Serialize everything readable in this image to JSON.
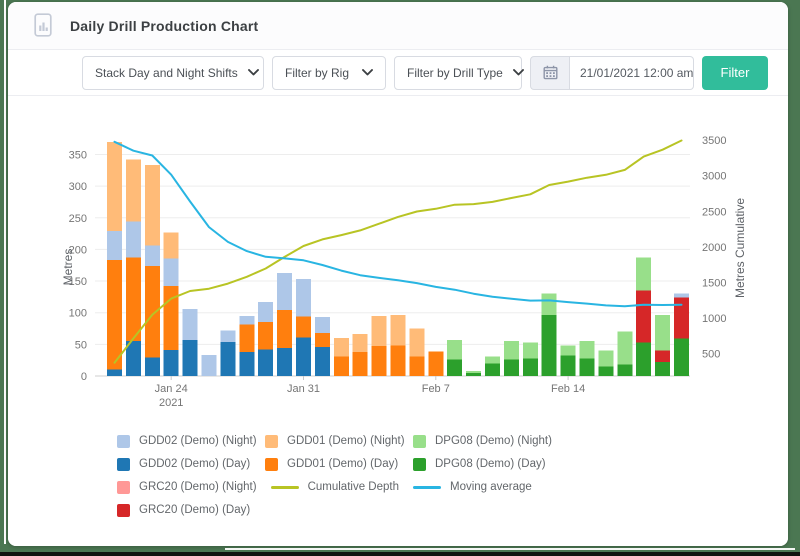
{
  "page": {
    "background_color": "#4b7752",
    "card_color": "#ffffff"
  },
  "header": {
    "title": "Daily Drill Production Chart"
  },
  "toolbar": {
    "stack_select": "Stack Day and Night Shifts",
    "rig_select": "Filter by Rig",
    "drill_type_select": "Filter by Drill Type",
    "date_value": "21/01/2021 12:00 am -",
    "filter_button": "Filter",
    "filter_button_color": "#31bd9b"
  },
  "chart_data": {
    "type": "bar",
    "subtype": "stacked-bars-with-lines",
    "ylabel_left": "Metres",
    "ylabel_right": "Metres Cumulative",
    "ylim_left": [
      0,
      375
    ],
    "ylim_right": [
      0,
      3500
    ],
    "left_ticks": [
      0,
      50,
      100,
      150,
      200,
      250,
      300,
      350
    ],
    "right_ticks": [
      500,
      1000,
      1500,
      2000,
      2500,
      3000,
      3500
    ],
    "grid": true,
    "x_tick_labels": [
      {
        "bar": 3,
        "lines": [
          "Jan 24",
          "2021"
        ]
      },
      {
        "bar": 10,
        "lines": [
          "Jan 31"
        ]
      },
      {
        "bar": 17,
        "lines": [
          "Feb 7"
        ]
      },
      {
        "bar": 24,
        "lines": [
          "Feb 14"
        ]
      }
    ],
    "series_colors": {
      "gdd02_day": "#1f77b4",
      "gdd02_night": "#aec7e8",
      "gdd01_day": "#ff7f0e",
      "gdd01_night": "#ffbb78",
      "dpg08_day": "#2ca02c",
      "dpg08_night": "#98df8a",
      "grc20_day": "#d62728",
      "grc20_night": "#ff9896",
      "cumulative": "#b8c424",
      "moving_avg": "#29b5e2"
    },
    "bars": [
      [
        [
          "gdd02_day",
          10
        ],
        [
          "gdd01_day",
          173
        ],
        [
          "gdd02_night",
          46
        ],
        [
          "gdd01_night",
          141
        ]
      ],
      [
        [
          "gdd02_day",
          55
        ],
        [
          "gdd01_day",
          132
        ],
        [
          "gdd02_night",
          57
        ],
        [
          "gdd01_night",
          98
        ]
      ],
      [
        [
          "gdd02_day",
          29
        ],
        [
          "gdd01_day",
          145
        ],
        [
          "gdd02_night",
          32
        ],
        [
          "gdd01_night",
          127
        ]
      ],
      [
        [
          "gdd02_day",
          41
        ],
        [
          "gdd01_day",
          101
        ],
        [
          "gdd02_night",
          44
        ],
        [
          "gdd01_night",
          41
        ]
      ],
      [
        [
          "gdd02_day",
          57
        ],
        [
          "gdd02_night",
          49
        ]
      ],
      [
        [
          "gdd02_night",
          33
        ]
      ],
      [
        [
          "gdd02_day",
          54
        ],
        [
          "gdd02_night",
          18
        ]
      ],
      [
        [
          "gdd02_day",
          38
        ],
        [
          "gdd01_day",
          43
        ],
        [
          "gdd02_night",
          14
        ]
      ],
      [
        [
          "gdd02_day",
          42
        ],
        [
          "gdd01_day",
          43
        ],
        [
          "gdd02_night",
          32
        ]
      ],
      [
        [
          "gdd02_day",
          44
        ],
        [
          "gdd01_day",
          60
        ],
        [
          "gdd02_night",
          59
        ]
      ],
      [
        [
          "gdd02_day",
          61
        ],
        [
          "gdd01_day",
          33
        ],
        [
          "gdd02_night",
          59
        ]
      ],
      [
        [
          "gdd02_day",
          46
        ],
        [
          "gdd01_day",
          22
        ],
        [
          "gdd02_night",
          25
        ]
      ],
      [
        [
          "gdd01_day",
          31
        ],
        [
          "gdd01_night",
          29
        ]
      ],
      [
        [
          "gdd01_day",
          38
        ],
        [
          "gdd01_night",
          28
        ]
      ],
      [
        [
          "gdd01_day",
          47
        ],
        [
          "gdd01_night",
          48
        ]
      ],
      [
        [
          "gdd01_day",
          48
        ],
        [
          "gdd01_night",
          48
        ]
      ],
      [
        [
          "gdd01_day",
          31
        ],
        [
          "gdd01_night",
          44
        ]
      ],
      [
        [
          "gdd01_day",
          39
        ]
      ],
      [
        [
          "dpg08_day",
          26
        ],
        [
          "dpg08_night",
          31
        ]
      ],
      [
        [
          "dpg08_day",
          5
        ],
        [
          "dpg08_night",
          3
        ]
      ],
      [
        [
          "dpg08_day",
          20
        ],
        [
          "dpg08_night",
          11
        ]
      ],
      [
        [
          "dpg08_day",
          26
        ],
        [
          "dpg08_night",
          29
        ]
      ],
      [
        [
          "dpg08_day",
          28
        ],
        [
          "dpg08_night",
          25
        ]
      ],
      [
        [
          "dpg08_day",
          96
        ],
        [
          "dpg08_night",
          34
        ]
      ],
      [
        [
          "dpg08_day",
          32
        ],
        [
          "dpg08_night",
          16
        ]
      ],
      [
        [
          "dpg08_day",
          28
        ],
        [
          "dpg08_night",
          27
        ]
      ],
      [
        [
          "dpg08_day",
          15
        ],
        [
          "dpg08_night",
          25
        ]
      ],
      [
        [
          "dpg08_day",
          18
        ],
        [
          "dpg08_night",
          52
        ]
      ],
      [
        [
          "dpg08_day",
          53
        ],
        [
          "grc20_day",
          82
        ],
        [
          "dpg08_night",
          52
        ]
      ],
      [
        [
          "dpg08_day",
          22
        ],
        [
          "grc20_day",
          18
        ],
        [
          "dpg08_night",
          56
        ]
      ],
      [
        [
          "dpg08_day",
          59
        ],
        [
          "grc20_day",
          65
        ],
        [
          "gdd02_night",
          6
        ]
      ]
    ],
    "lines": [
      {
        "name": "Cumulative Depth",
        "key": "cumulative",
        "axis": "right",
        "values": [
          370,
          712,
          1045,
          1272,
          1378,
          1411,
          1483,
          1578,
          1695,
          1858,
          2011,
          2104,
          2164,
          2230,
          2325,
          2421,
          2496,
          2535,
          2592,
          2600,
          2631,
          2686,
          2739,
          2869,
          2917,
          2972,
          3012,
          3082,
          3269,
          3365,
          3495
        ]
      },
      {
        "name": "Moving average",
        "key": "moving_avg",
        "axis": "left",
        "values": [
          370,
          356,
          348.3,
          318,
          275.6,
          235.2,
          211.9,
          197.3,
          188.3,
          185.8,
          182.8,
          175.3,
          166.5,
          159.3,
          155,
          151.3,
          146.8,
          140.8,
          136.4,
          130,
          125.3,
          122.1,
          119.1,
          119.5,
          116.7,
          114.3,
          111.6,
          110.1,
          112.7,
          112.2,
          112.7
        ]
      }
    ],
    "legend_rows": [
      [
        {
          "type": "square",
          "key": "gdd02_night",
          "label": "GDD02 (Demo) (Night)"
        },
        {
          "type": "square",
          "key": "gdd01_night",
          "label": "GDD01 (Demo) (Night)"
        },
        {
          "type": "square",
          "key": "dpg08_night",
          "label": "DPG08 (Demo) (Night)"
        }
      ],
      [
        {
          "type": "square",
          "key": "gdd02_day",
          "label": "GDD02 (Demo) (Day)"
        },
        {
          "type": "square",
          "key": "gdd01_day",
          "label": "GDD01 (Demo) (Day)"
        },
        {
          "type": "square",
          "key": "dpg08_day",
          "label": "DPG08 (Demo) (Day)"
        }
      ],
      [
        {
          "type": "square",
          "key": "grc20_night",
          "label": "GRC20 (Demo) (Night)"
        },
        {
          "type": "line",
          "key": "cumulative",
          "label": "Cumulative Depth"
        },
        {
          "type": "line",
          "key": "moving_avg",
          "label": "Moving average"
        }
      ],
      [
        {
          "type": "square",
          "key": "grc20_day",
          "label": "GRC20 (Demo) (Day)"
        }
      ]
    ]
  }
}
